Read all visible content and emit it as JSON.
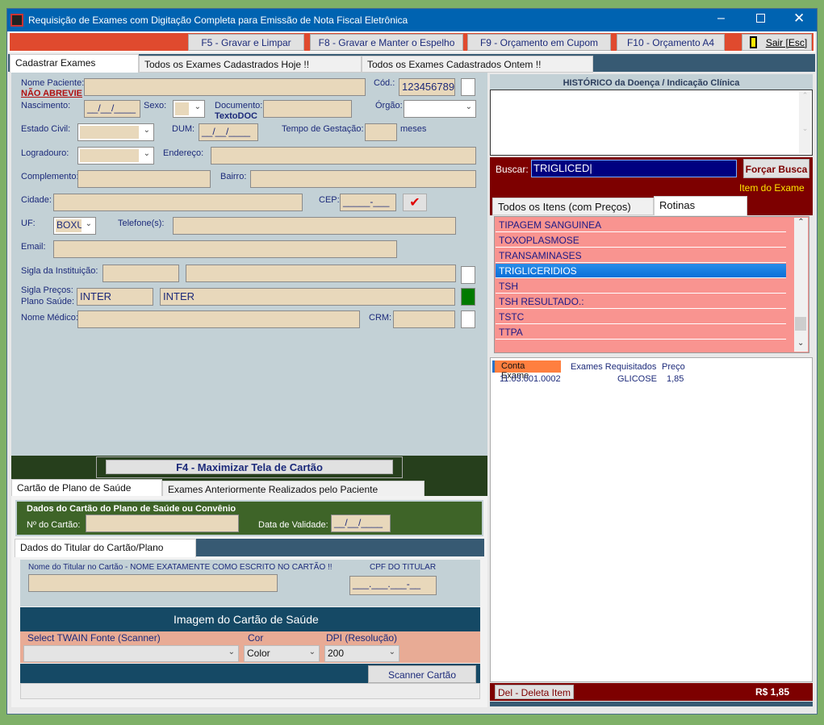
{
  "window": {
    "title": "Requisição de Exames com Digitação Completa para Emissão de Nota Fiscal Eletrônica"
  },
  "toolbar": {
    "f5": "F5 - Gravar e Limpar",
    "f8": "F8 - Gravar e Manter o Espelho",
    "f9": "F9 - Orçamento em Cupom",
    "f10": "F10 - Orçamento A4",
    "exit": "Sair [Esc]"
  },
  "main_tabs": [
    "Cadastrar Exames",
    "Todos os Exames Cadastrados Hoje !!",
    "Todos os Exames Cadastrados Ontem !!"
  ],
  "form": {
    "nome_paciente": "Nome Paciente:",
    "nao_abrevie": "NÃO ABREVIE",
    "cod": "Cód.:",
    "cod_value": "123456789",
    "nascimento": "Nascimento:",
    "date_mask": "__/__/____",
    "sexo": "Sexo:",
    "documento": "Documento:",
    "textodoc": "TextoDOC",
    "orgao": "Órgão:",
    "estado_civil": "Estado Civil:",
    "dum": "DUM:",
    "tempo_gestacao": "Tempo de Gestação:",
    "meses": "meses",
    "logradouro": "Logradouro:",
    "endereco": "Endereço:",
    "complemento": "Complemento:",
    "bairro": "Bairro:",
    "cidade": "Cidade:",
    "cep": "CEP:",
    "cep_mask": "_____-___",
    "uf": "UF:",
    "uf_value": "BOXU",
    "telefone": "Telefone(s):",
    "email": "Email:",
    "sigla_instituicao": "Sigla da Instituição:",
    "sigla_precos": "Sigla Preços:",
    "plano_saude": "Plano Saúde:",
    "sigla_value": "INTER",
    "plano_value": "INTER",
    "nome_medico": "Nome Médico:",
    "crm": "CRM:"
  },
  "card": {
    "maximize": "F4 - Maximizar Tela de Cartão",
    "tabs": [
      "Cartão de Plano de Saúde",
      "Exames Anteriormente Realizados pelo Paciente"
    ],
    "dados_cartao": "Dados do Cartão do Plano de Saúde ou Convênio",
    "numero": "Nº do Cartão:",
    "validade": "Data de Validade:",
    "validade_mask": "__/__/____",
    "titular_tab": "Dados do Titular do Cartão/Plano",
    "nome_titular": "Nome do Titular no Cartão - NOME EXATAMENTE COMO ESCRITO NO CARTÃO !!",
    "cpf": "CPF DO TITULAR",
    "cpf_mask": "___.___.___-__",
    "imagem": "Imagem do Cartão de Saúde",
    "twain": "Select TWAIN Fonte (Scanner)",
    "cor": "Cor",
    "cor_value": "Color",
    "dpi": "DPI (Resolução)",
    "dpi_value": "200",
    "scanner": "Scanner Cartão"
  },
  "right": {
    "historico": "HISTÓRICO da Doença / Indicação Clínica",
    "buscar": "Buscar:",
    "buscar_value": "TRIGLICED",
    "forcar": "Forçar Busca",
    "item_exame": "Item do Exame",
    "tabs": [
      "Todos os Itens (com Preços)",
      "Rotinas"
    ],
    "items": [
      "TIPAGEM SANGUINEA",
      "TOXOPLASMOSE",
      "TRANSAMINASES",
      "TRIGLICERIDIOS",
      "TSH",
      "TSH RESULTADO.:",
      "TSTC",
      "TTPA"
    ],
    "selected_item": "TRIGLICERIDIOS",
    "table": {
      "headers": [
        "Conta Exame",
        "Exames Requisitados",
        "Preço"
      ],
      "rows": [
        [
          "11.03.001.0002",
          "GLICOSE",
          "1,85"
        ]
      ]
    },
    "delete": "Del - Deleta Item",
    "total": "R$ 1,85"
  },
  "colors": {
    "title": "#0063b1",
    "toolbar": "#e04a2e",
    "form_bg": "#c3d1d6",
    "field": "#e8d8bb",
    "dark_red": "#7d0000",
    "list_row": "#f99490"
  }
}
